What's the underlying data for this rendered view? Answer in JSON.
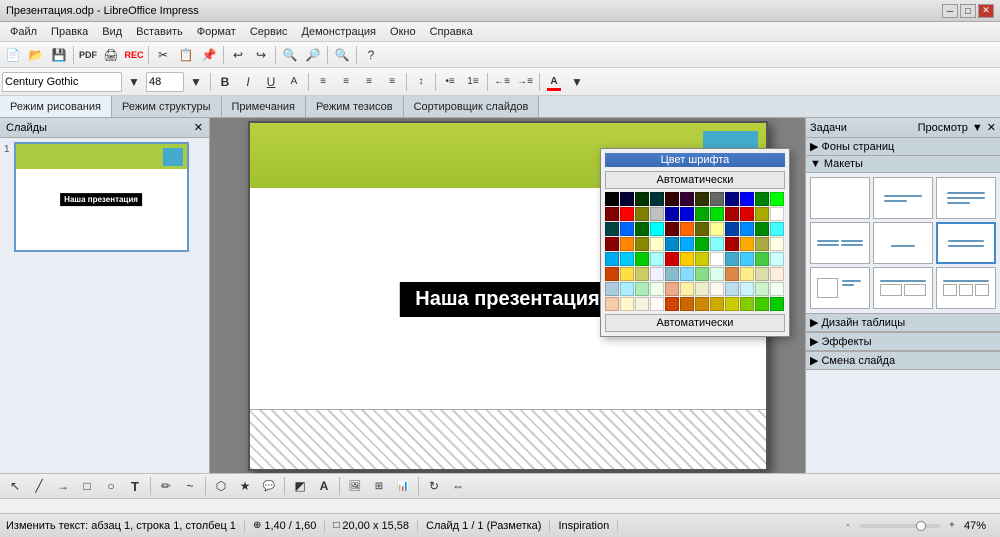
{
  "titlebar": {
    "title": "Презентация.odp - LibreOffice Impress",
    "min": "─",
    "max": "□",
    "close": "✕"
  },
  "menubar": {
    "items": [
      "Файл",
      "Правка",
      "Вид",
      "Вставить",
      "Формат",
      "Сервис",
      "Демонстрация",
      "Окно",
      "Справка"
    ]
  },
  "toolbar1": {
    "font_name": "Century Gothic",
    "font_size": "48"
  },
  "tabs": {
    "items": [
      "Режим рисования",
      "Режим структуры",
      "Примечания",
      "Режим тезисов",
      "Сортировщик слайдов"
    ]
  },
  "slides_panel": {
    "title": "Слайды",
    "close": "✕",
    "slide_number": "1"
  },
  "slide": {
    "title_text": "Наша презентация"
  },
  "color_picker": {
    "title": "Цвет шрифта",
    "auto_top": "Автоматически",
    "auto_bottom": "Автоматически"
  },
  "right_panel": {
    "title": "Задачи",
    "view": "Просмотр",
    "close": "✕",
    "page_backgrounds": "Фоны страниц",
    "layouts": "Макеты",
    "table_design": "Дизайн таблицы",
    "effects": "Эффекты",
    "slide_change": "Смена слайда"
  },
  "statusbar": {
    "text_info": "Изменить текст: абзац 1, строка 1, столбец 1",
    "position": "1,40 / 1,60",
    "size": "20,00 x 15,58",
    "slide_info": "Слайд 1 / 1 (Разметка)",
    "theme": "Inspiration",
    "zoom": "47%"
  },
  "colors": {
    "grid": [
      "#000000",
      "#000033",
      "#003300",
      "#003333",
      "#330000",
      "#330033",
      "#333300",
      "#666666",
      "#000080",
      "#0000ff",
      "#008000",
      "#00ff00",
      "#800000",
      "#ff0000",
      "#808000",
      "#c0c0c0",
      "#0000aa",
      "#0000dd",
      "#00aa00",
      "#00dd00",
      "#aa0000",
      "#dd0000",
      "#aaaa00",
      "#ffffff",
      "#004444",
      "#0066ff",
      "#006600",
      "#00ffff",
      "#660000",
      "#ff6600",
      "#666600",
      "#ffff99",
      "#0044aa",
      "#0088ff",
      "#008800",
      "#44ffff",
      "#880000",
      "#ff8800",
      "#888800",
      "#ffffcc",
      "#0088cc",
      "#00aaff",
      "#00aa00",
      "#88ffff",
      "#aa0000",
      "#ffaa00",
      "#aaaa44",
      "#ffffe8",
      "#00aaee",
      "#00ccff",
      "#00cc00",
      "#aaffff",
      "#cc0000",
      "#ffcc00",
      "#cccc00",
      "#ffffff",
      "#44aacc",
      "#44ccff",
      "#44cc44",
      "#ccffff",
      "#cc4400",
      "#ffdd44",
      "#cccc66",
      "#f0f0ff",
      "#88bbcc",
      "#88ddff",
      "#88dd88",
      "#ddfff0",
      "#dd8844",
      "#ffee88",
      "#ddddaa",
      "#ffeedd",
      "#aaccdd",
      "#aaeeff",
      "#aaeebb",
      "#eeffee",
      "#eeaa88",
      "#fff0aa",
      "#eeeecc",
      "#fff8f0",
      "#bbddee",
      "#ccf4ff",
      "#ccf4cc",
      "#f4fff4",
      "#f4ccaa",
      "#fff8cc",
      "#f4f4dd",
      "#fffcf8",
      "#cc4400",
      "#cc6600",
      "#cc8800",
      "#ccaa00",
      "#cccc00",
      "#88cc00",
      "#44cc00",
      "#00cc00"
    ]
  },
  "icons": {
    "arrow": "↖",
    "line": "╱",
    "rect": "□",
    "ellipse": "○",
    "text": "T",
    "pencil": "✏",
    "curve": "~",
    "polygon": "⬡",
    "star": "★",
    "callout": "💬",
    "shadow": "◩",
    "fontwork": "A",
    "image": "🖼",
    "table": "⊞",
    "chart": "📊",
    "triangle": "▶",
    "left": "◀",
    "right": "▶",
    "expand": "⊞",
    "close": "✕",
    "new": "📄",
    "open": "📂",
    "save": "💾",
    "undo": "↩",
    "redo": "↪",
    "bold": "B",
    "italic": "I",
    "underline": "U"
  }
}
